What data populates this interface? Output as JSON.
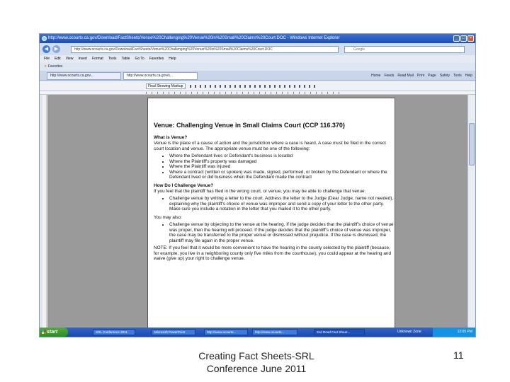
{
  "browser": {
    "title": "http://www.ocourts.ca.gov/Download/FactSheets/Venue%20Challenging%20Venue%20in%20Small%20Claims%20Court.DOC - Windows Internet Explorer",
    "address": "http://www.ocourts.ca.gov/Download/FactSheets/Venue%20Challenging%20Venue%20in%20Small%20Claims%20Court.DOC",
    "search_placeholder": "Google",
    "menu": [
      "File",
      "Edit",
      "View",
      "Insert",
      "Format",
      "Tools",
      "Table",
      "Go To",
      "Favorites",
      "Help"
    ],
    "favorites_label": "Favorites",
    "tabs": [
      "http://www.ocourts.ca.gov...",
      "http://www.ocourts.ca.gov/s..."
    ],
    "command_bar": [
      "Home",
      "Feeds",
      "Read Mail",
      "Print",
      "Page",
      "Safety",
      "Tools",
      "Help"
    ],
    "zoom_field": "Final Showing Markup"
  },
  "document": {
    "heading": "Venue: Challenging Venue in Small Claims Court (CCP 116.370)",
    "s1_title": "What is Venue?",
    "s1_body": "Venue is the place of a cause of action and the jurisdiction where a case is heard. A case must be filed in the correct court location and venue. The appropriate venue must be one of the following:",
    "s1_bullets": [
      "Where the Defendant lives or Defendant's business is located",
      "Where the Plaintiff's property was damaged",
      "Where the Plaintiff was injured",
      "Where a contract (written or spoken) was made, signed, performed, or broken by the Defendant or where the Defendant lived or did business when the Defendant made the contract"
    ],
    "s2_title": "How Do I Challenge Venue?",
    "s2_body": "If you feel that the plaintiff has filed in the wrong court, or venue, you may be able to challenge that venue.",
    "s2_bullets": [
      "Challenge venue by writing a letter to the court. Address the letter to the Judge (Dear Judge, name not needed), explaining why the plaintiff's choice of venue was improper and send a copy of your letter to the other party. Make sure you include a notation in the letter that you mailed it to the other party."
    ],
    "s3_body": "You may also:",
    "s3_bullets": [
      "Challenge venue by objecting to the venue at the hearing. If the judge decides that the plaintiff's choice of venue was proper, then the hearing will proceed. If the judge decides that the plaintiff's choice of venue was improper, the case may be transferred to the proper venue or dismissed without prejudice. If the case is dismissed, the plaintiff may file again in the proper venue."
    ],
    "note": "NOTE: If you feel that it would be more convenient to have the hearing in the county selected by the plaintiff (because, for example, you live in a neighboring county only five miles from the courthouse), you could appear at the hearing and waive (give up) your right to challenge venue."
  },
  "taskbar": {
    "start_label": "start",
    "items": [
      "SRL Conference 2011",
      "Microsoft PowerPoint",
      "http://www.ocourts...",
      "http://www.ocourts...",
      "2nd Read Fact Sheet..."
    ],
    "tray_item": "Unknown Zone",
    "clock": "12:05 PM"
  },
  "slide_footer": {
    "caption": "Creating Fact Sheets-SRL Conference June 2011",
    "page_number": "11"
  }
}
